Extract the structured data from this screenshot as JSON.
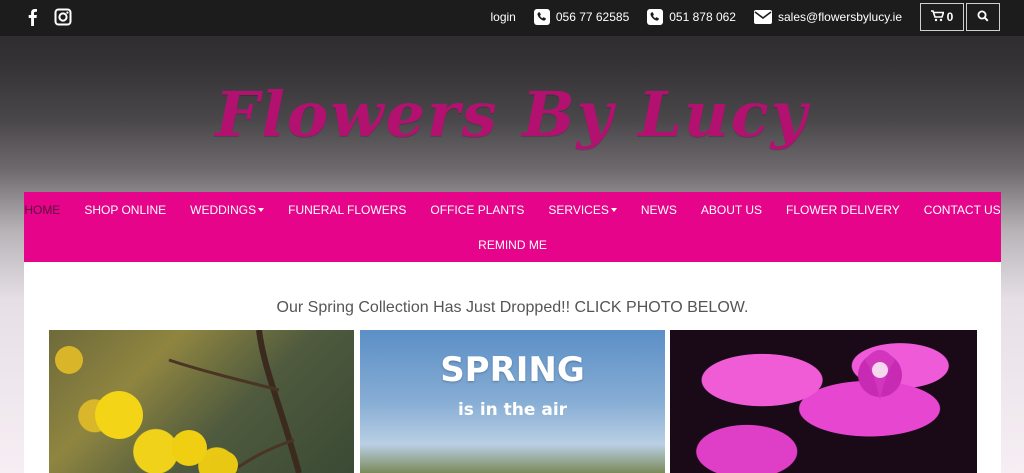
{
  "social": {
    "facebook_icon": "facebook-icon",
    "instagram_icon": "instagram-icon"
  },
  "topbar": {
    "login": "login",
    "phone1": "056 77 62585",
    "phone2": "051 878 062",
    "email": "sales@flowersbylucy.ie",
    "cart_count": "0"
  },
  "logo": "Flowers By Lucy",
  "nav": {
    "row1": [
      "HOME",
      "SHOP ONLINE",
      "WEDDINGS",
      "FUNERAL FLOWERS",
      "OFFICE PLANTS",
      "SERVICES",
      "NEWS",
      "ABOUT US",
      "FLOWER DELIVERY",
      "CONTACT US"
    ],
    "row2": [
      "REMIND ME"
    ]
  },
  "main": {
    "headline": "Our Spring Collection Has Just Dropped!! CLICK PHOTO BELOW.",
    "photo2_title": "SPRING",
    "photo2_sub": "is in the air"
  },
  "colors": {
    "brand": "#e6048a",
    "logo": "#b3116f"
  }
}
